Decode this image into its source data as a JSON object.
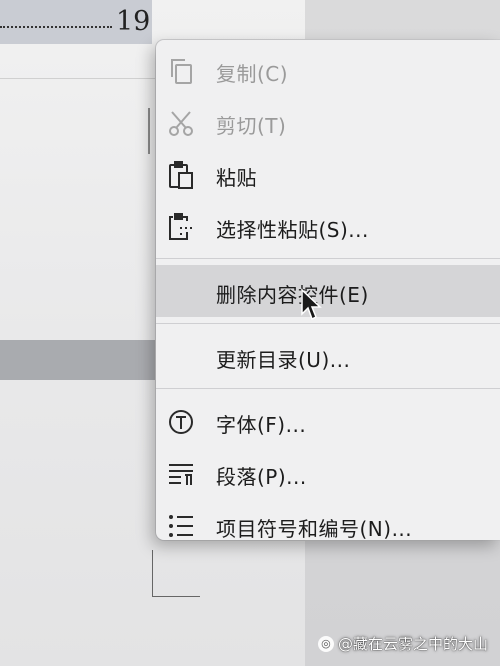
{
  "document": {
    "toc_page_number": "19"
  },
  "context_menu": {
    "items": [
      {
        "label": "复制(C)",
        "icon": "copy-icon",
        "enabled": false
      },
      {
        "label": "剪切(T)",
        "icon": "cut-icon",
        "enabled": false
      },
      {
        "label": "粘贴",
        "icon": "paste-icon",
        "enabled": true
      },
      {
        "label": "选择性粘贴(S)...",
        "icon": "paste-special-icon",
        "enabled": true
      },
      {
        "label": "删除内容控件(E)",
        "icon": "",
        "enabled": true,
        "highlighted": true
      },
      {
        "label": "更新目录(U)...",
        "icon": "",
        "enabled": true
      },
      {
        "label": "字体(F)...",
        "icon": "font-icon",
        "enabled": true
      },
      {
        "label": "段落(P)...",
        "icon": "paragraph-icon",
        "enabled": true
      },
      {
        "label": "项目符号和编号(N)...",
        "icon": "bullet-list-icon",
        "enabled": true
      }
    ]
  },
  "watermark": {
    "text": "@藏在云雾之中的大山"
  },
  "colors": {
    "menu_background": "#f0f0f1",
    "highlight": "#d5d5d7",
    "disabled_text": "#9a9a9a",
    "text": "#1c1c1c"
  }
}
